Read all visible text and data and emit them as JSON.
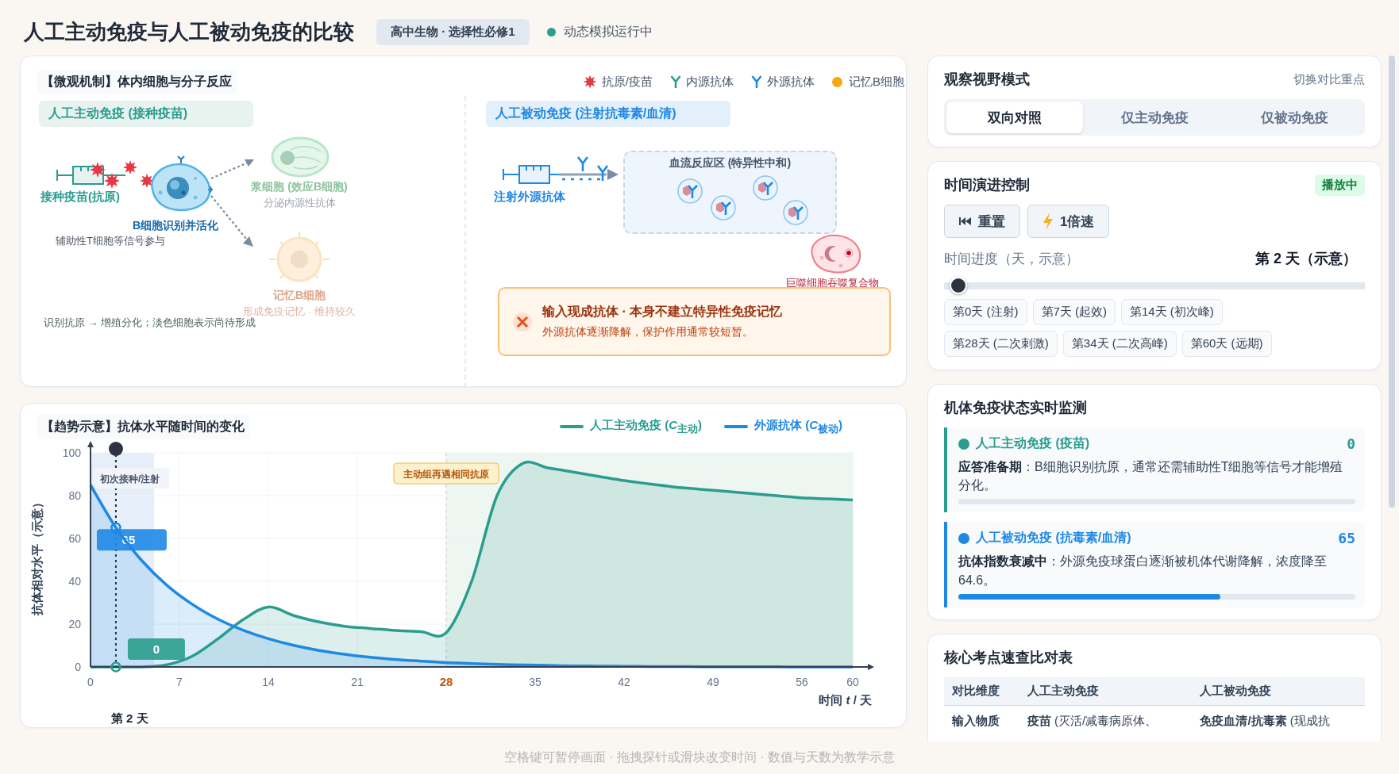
{
  "header": {
    "title": "人工主动免疫与人工被动免疫的比较",
    "badge": "高中生物 · 选择性必修1",
    "status": {
      "text": "动态模拟运行中",
      "color": "#2a9d8f"
    }
  },
  "micro": {
    "title": "【微观机制】体内细胞与分子反应",
    "legend": [
      {
        "kind": "antigen",
        "label": "抗原/疫苗"
      },
      {
        "kind": "endogenous",
        "label": "内源抗体"
      },
      {
        "kind": "exogenous",
        "label": "外源抗体"
      },
      {
        "kind": "memory",
        "label": "记忆B细胞"
      }
    ],
    "active": {
      "title": "人工主动免疫 (接种疫苗)",
      "vaccine_label": "接种疫苗(抗原)",
      "bcell_label": "B细胞识别并活化",
      "bcell_note": "辅助性T细胞等信号参与",
      "plasma": {
        "formed": false,
        "label": "浆细胞 (效应B细胞)",
        "note": "分泌内源性抗体"
      },
      "memory": {
        "formed": false,
        "label": "记忆B细胞",
        "note": "形成免疫记忆 · 维持较久"
      },
      "footnote": "识别抗原 → 增殖分化；淡色细胞表示尚待形成"
    },
    "passive": {
      "title": "人工被动免疫 (注射抗毒素/血清)",
      "inject_label": "注射外源抗体",
      "zone_title": "血流反应区 (特异性中和)",
      "macrophage_label": "巨噬细胞吞噬复合物",
      "alert": {
        "title": "输入现成抗体 · 本身不建立特异性免疫记忆",
        "text": "外源抗体逐渐降解，保护作用通常较短暂。"
      }
    }
  },
  "trend": {
    "title": "【趋势示意】抗体水平随时间的变化",
    "probe": {
      "label": "第 2 天",
      "readings": [
        {
          "text": "0"
        },
        {
          "text": "65"
        }
      ]
    },
    "chart_data": {
      "type": "area",
      "grid": true,
      "xlabel": "时间 *t* / 天",
      "ylabel": "抗体相对水平（示意）",
      "x": [
        0,
        2,
        4,
        6,
        8,
        10,
        12,
        14,
        16,
        18,
        20,
        22,
        24,
        26,
        28,
        30,
        32,
        34,
        36,
        38,
        40,
        42,
        44,
        46,
        48,
        50,
        52,
        54,
        56,
        58,
        60
      ],
      "series": [
        {
          "name": "人工主动免疫 (*C*$_{主动}$)",
          "color": "#2a9d8f",
          "values": [
            0,
            0,
            0,
            1,
            5,
            13,
            22,
            28,
            24,
            21,
            19,
            18,
            17,
            16.5,
            16,
            40,
            80,
            95,
            93,
            91,
            89,
            87,
            85.5,
            84,
            83,
            82,
            81,
            80,
            79,
            78.5,
            78
          ]
        },
        {
          "name": "外源抗体 (*C*$_{被动}$)",
          "color": "#1e88e5",
          "values": [
            85,
            65.1,
            49.9,
            38.2,
            29.3,
            22.4,
            17.2,
            13.2,
            10.1,
            7.7,
            5.9,
            4.5,
            3.5,
            2.7,
            2,
            1.6,
            1.2,
            0.9,
            0.7,
            0.5,
            0.4,
            0.3,
            0.2,
            0.2,
            0.1,
            0.1,
            0.1,
            0.1,
            0,
            0,
            0
          ]
        }
      ],
      "xlim": [
        0,
        60
      ],
      "ylim": [
        0,
        100
      ],
      "xticks": [
        0,
        7,
        14,
        21,
        28,
        35,
        42,
        49,
        56,
        60
      ],
      "yticks": [
        0,
        20,
        40,
        60,
        80,
        100
      ],
      "ref_lines": [
        {
          "value": 28,
          "axis": "x"
        }
      ],
      "annotations": [
        "初次接种/注射",
        "主动组再遇相同抗原"
      ]
    }
  },
  "mode": {
    "title": "观察视野模式",
    "hint": "切换对比重点",
    "options": [
      {
        "label": "双向对照",
        "selected": true
      },
      {
        "label": "仅主动免疫",
        "selected": false
      },
      {
        "label": "仅被动免疫",
        "selected": false
      }
    ]
  },
  "control": {
    "title": "时间演进控制",
    "badge": "播放中",
    "buttons": [
      {
        "kind": "reset",
        "label": "重置"
      },
      {
        "kind": "speed",
        "label": "1倍速"
      }
    ],
    "progress_label": "时间进度（天，示意）",
    "progress_value": "第 2 天（示意）",
    "slider": {
      "level": 0.0333
    },
    "presets": [
      "第0天 (注射)",
      "第7天 (起效)",
      "第14天 (初次峰)",
      "第28天 (二次刺激)",
      "第34天 (二次高峰)",
      "第60天 (远期)"
    ]
  },
  "monitor": {
    "title": "机体免疫状态实时监测",
    "cards": [
      {
        "title": "人工主动免疫 (疫苗)",
        "value": "0",
        "text": "**应答准备期**：B细胞识别抗原，通常还需辅助性T细胞等信号才能增殖分化。",
        "level": 0,
        "color": "#2a9d8f"
      },
      {
        "title": "人工被动免疫 (抗毒素/血清)",
        "value": "65",
        "text": "**抗体指数衰减中**：外源免疫球蛋白逐渐被机体代谢降解，浓度降至64.6。",
        "level": 0.66,
        "color": "#1e88e5"
      }
    ]
  },
  "table": {
    "title": "核心考点速查比对表",
    "columns": [
      "对比维度",
      "人工主动免疫",
      "人工被动免疫"
    ],
    "rows": [
      [
        "输入物质",
        "**疫苗** (灭活/减毒病原体、",
        "**免疫血清/抗毒素** (现成抗"
      ]
    ]
  },
  "footer": "空格键可暂停画面 · 拖拽探针或滑块改变时间 · 数值与天数为教学示意"
}
